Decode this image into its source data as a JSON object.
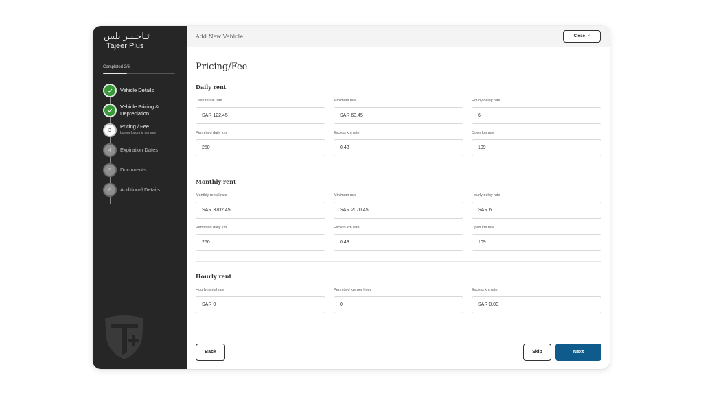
{
  "brand": {
    "logo_ar": "تـاجـيـر بلس",
    "logo_en": "Tajeer Plus"
  },
  "progress": {
    "label": "Completed 2/6",
    "fraction": 0.333
  },
  "steps": [
    {
      "number": "1",
      "label": "Vehicle Details",
      "status": "done"
    },
    {
      "number": "2",
      "label_line1": "Vehicle Pricing &",
      "label_line2": "Depreciation",
      "status": "done"
    },
    {
      "number": "3",
      "label": "Pricing / Fee",
      "sub": "Lorem Ipsum is dummy",
      "status": "current"
    },
    {
      "number": "4",
      "label": "Expiration Dates",
      "status": "todo"
    },
    {
      "number": "5",
      "label": "Documents",
      "status": "todo"
    },
    {
      "number": "6",
      "label": "Additional Details",
      "status": "todo"
    }
  ],
  "header": {
    "title": "Add New Vehicle",
    "close_label": "Close",
    "close_icon": "×"
  },
  "page_title": "Pricing/Fee",
  "daily": {
    "title": "Daily rent",
    "fields": [
      {
        "label": "Daily rental rate",
        "value": "SAR 122.45"
      },
      {
        "label": "Minimum rate",
        "value": "SAR 63.45"
      },
      {
        "label": "Hourly delay rate",
        "value": "6"
      },
      {
        "label": "Permitted daily km",
        "value": "250"
      },
      {
        "label": "Excess km rate",
        "value": "0.43"
      },
      {
        "label": "Open km rate",
        "value": "109"
      }
    ]
  },
  "monthly": {
    "title": "Monthly rent",
    "fields": [
      {
        "label": "Monthly rental rate",
        "value": "SAR 3702.45"
      },
      {
        "label": "Minimum rate",
        "value": "SAR 2070.45"
      },
      {
        "label": "Hourly delay rate",
        "value": "SAR 6"
      },
      {
        "label": "Permitted daily km",
        "value": "250"
      },
      {
        "label": "Excess km rate",
        "value": "0.43"
      },
      {
        "label": "Open km rate",
        "value": "109"
      }
    ]
  },
  "hourly": {
    "title": "Hourly rent",
    "fields": [
      {
        "label": "Hourly rental rate",
        "value": "SAR 0"
      },
      {
        "label": "Permitted km per hour",
        "value": "0"
      },
      {
        "label": "Excess km rate",
        "value": "SAR 0.00"
      }
    ]
  },
  "footer": {
    "back_label": "Back",
    "skip_label": "Skip",
    "next_label": "Next"
  },
  "colors": {
    "sidebar_bg": "#262626",
    "step_done": "#3a9a3a",
    "primary": "#0f5c8c"
  }
}
